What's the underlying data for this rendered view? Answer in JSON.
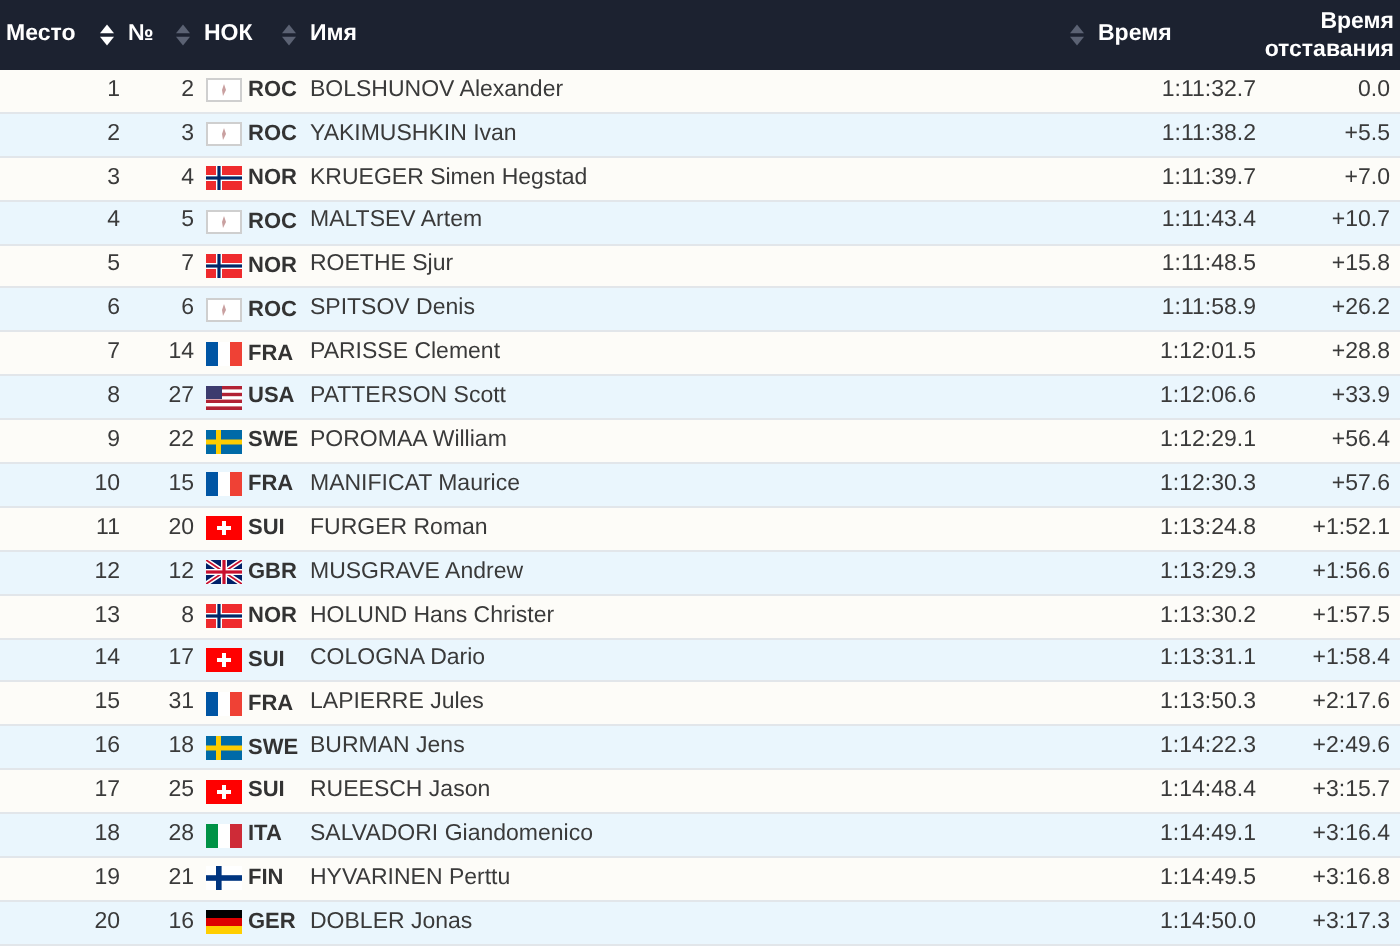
{
  "columns": [
    {
      "label": "Место",
      "sortable": false,
      "selected": false
    },
    {
      "label": "№",
      "sortable": true,
      "selected": true
    },
    {
      "label": "НОК",
      "sortable": true,
      "selected": false
    },
    {
      "label": "Имя",
      "sortable": true,
      "selected": false
    },
    {
      "label": "Время",
      "sortable": true,
      "selected": false
    },
    {
      "label": "Время отставания",
      "sortable": false,
      "selected": false
    }
  ],
  "rows": [
    {
      "place": "1",
      "bib": "2",
      "kind": "roc",
      "noc": "ROC",
      "name": "BOLSHUNOV Alexander",
      "time": "1:11:32.7",
      "behind": "0.0"
    },
    {
      "place": "2",
      "bib": "3",
      "kind": "roc",
      "noc": "ROC",
      "name": "YAKIMUSHKIN Ivan",
      "time": "1:11:38.2",
      "behind": "+5.5"
    },
    {
      "place": "3",
      "bib": "4",
      "kind": "nor",
      "noc": "NOR",
      "name": "KRUEGER Simen Hegstad",
      "time": "1:11:39.7",
      "behind": "+7.0"
    },
    {
      "place": "4",
      "bib": "5",
      "kind": "roc",
      "noc": "ROC",
      "name": "MALTSEV Artem",
      "time": "1:11:43.4",
      "behind": "+10.7"
    },
    {
      "place": "5",
      "bib": "7",
      "kind": "nor",
      "noc": "NOR",
      "name": "ROETHE Sjur",
      "time": "1:11:48.5",
      "behind": "+15.8"
    },
    {
      "place": "6",
      "bib": "6",
      "kind": "roc",
      "noc": "ROC",
      "name": "SPITSOV Denis",
      "time": "1:11:58.9",
      "behind": "+26.2"
    },
    {
      "place": "7",
      "bib": "14",
      "kind": "fra",
      "noc": "FRA",
      "name": "PARISSE Clement",
      "time": "1:12:01.5",
      "behind": "+28.8"
    },
    {
      "place": "8",
      "bib": "27",
      "kind": "usa",
      "noc": "USA",
      "name": "PATTERSON Scott",
      "time": "1:12:06.6",
      "behind": "+33.9"
    },
    {
      "place": "9",
      "bib": "22",
      "kind": "swe",
      "noc": "SWE",
      "name": "POROMAA William",
      "time": "1:12:29.1",
      "behind": "+56.4"
    },
    {
      "place": "10",
      "bib": "15",
      "kind": "fra",
      "noc": "FRA",
      "name": "MANIFICAT Maurice",
      "time": "1:12:30.3",
      "behind": "+57.6"
    },
    {
      "place": "11",
      "bib": "20",
      "kind": "sui",
      "noc": "SUI",
      "name": "FURGER Roman",
      "time": "1:13:24.8",
      "behind": "+1:52.1"
    },
    {
      "place": "12",
      "bib": "12",
      "kind": "gbr",
      "noc": "GBR",
      "name": "MUSGRAVE Andrew",
      "time": "1:13:29.3",
      "behind": "+1:56.6"
    },
    {
      "place": "13",
      "bib": "8",
      "kind": "nor",
      "noc": "NOR",
      "name": "HOLUND Hans Christer",
      "time": "1:13:30.2",
      "behind": "+1:57.5"
    },
    {
      "place": "14",
      "bib": "17",
      "kind": "sui",
      "noc": "SUI",
      "name": "COLOGNA Dario",
      "time": "1:13:31.1",
      "behind": "+1:58.4"
    },
    {
      "place": "15",
      "bib": "31",
      "kind": "fra",
      "noc": "FRA",
      "name": "LAPIERRE Jules",
      "time": "1:13:50.3",
      "behind": "+2:17.6"
    },
    {
      "place": "16",
      "bib": "18",
      "kind": "swe",
      "noc": "SWE",
      "name": "BURMAN Jens",
      "time": "1:14:22.3",
      "behind": "+2:49.6"
    },
    {
      "place": "17",
      "bib": "25",
      "kind": "sui",
      "noc": "SUI",
      "name": "RUEESCH Jason",
      "time": "1:14:48.4",
      "behind": "+3:15.7"
    },
    {
      "place": "18",
      "bib": "28",
      "kind": "ita",
      "noc": "ITA",
      "name": "SALVADORI Giandomenico",
      "time": "1:14:49.1",
      "behind": "+3:16.4"
    },
    {
      "place": "19",
      "bib": "21",
      "kind": "fin",
      "noc": "FIN",
      "name": "HYVARINEN Perttu",
      "time": "1:14:49.5",
      "behind": "+3:16.8"
    },
    {
      "place": "20",
      "bib": "16",
      "kind": "ger",
      "noc": "GER",
      "name": "DOBLER Jonas",
      "time": "1:14:50.0",
      "behind": "+3:17.3"
    }
  ]
}
